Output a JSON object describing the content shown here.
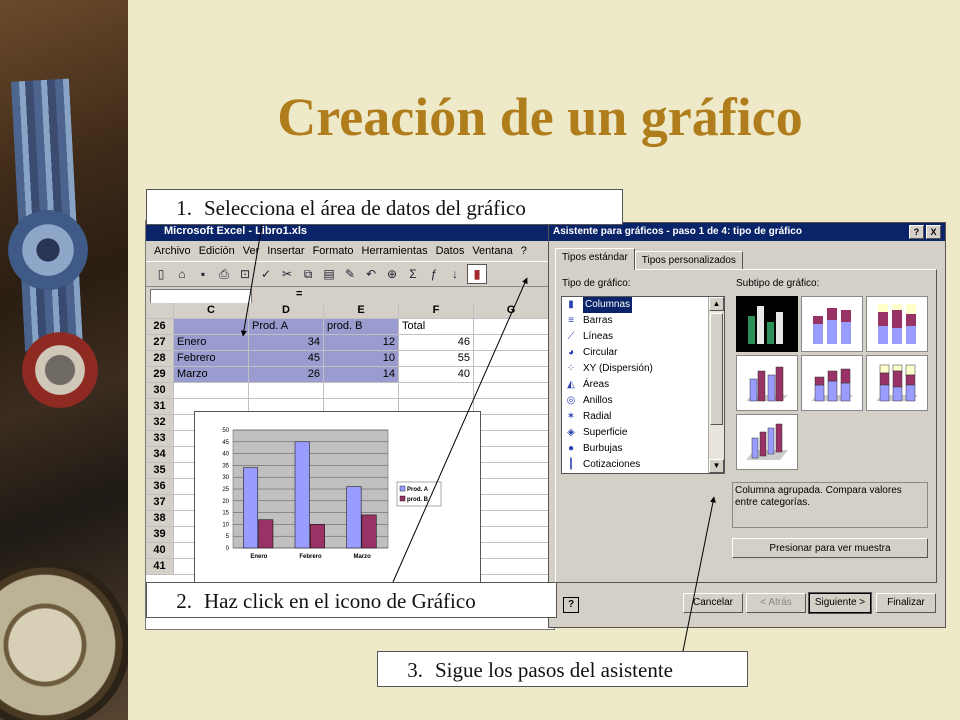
{
  "slide": {
    "title": "Creación de un gráfico",
    "steps": [
      {
        "num": "1.",
        "text": "Selecciona el área de datos del gráfico"
      },
      {
        "num": "2.",
        "text": "Haz click en el icono de Gráfico"
      },
      {
        "num": "3.",
        "text": "Sigue los pasos del asistente"
      }
    ]
  },
  "excel": {
    "window_title": "Microsoft Excel - Libro1.xls",
    "menu": [
      "Archivo",
      "Edición",
      "Ver",
      "Insertar",
      "Formato",
      "Herramientas",
      "Datos",
      "Ventana",
      "?"
    ],
    "toolbar_icons": [
      "new-icon",
      "open-icon",
      "save-icon",
      "print-icon",
      "preview-icon",
      "spell-icon",
      "cut-icon",
      "copy-icon",
      "paste-icon",
      "format-painter-icon",
      "undo-icon",
      "hyperlink-icon",
      "autosum-icon",
      "function-icon",
      "sort-icon",
      "chart-wizard-icon"
    ],
    "formula_symbol": "=",
    "columns": [
      "C",
      "D",
      "E",
      "F",
      "G"
    ],
    "rows": [
      {
        "n": "26",
        "cells": [
          "",
          "Prod. A",
          "prod. B",
          "Total",
          ""
        ]
      },
      {
        "n": "27",
        "cells": [
          "Enero",
          "34",
          "12",
          "46",
          ""
        ]
      },
      {
        "n": "28",
        "cells": [
          "Febrero",
          "45",
          "10",
          "55",
          ""
        ]
      },
      {
        "n": "29",
        "cells": [
          "Marzo",
          "26",
          "14",
          "40",
          ""
        ]
      },
      {
        "n": "30",
        "cells": [
          "",
          "",
          "",
          "",
          ""
        ]
      },
      {
        "n": "31",
        "cells": [
          "",
          "",
          "",
          "",
          ""
        ]
      },
      {
        "n": "32",
        "cells": [
          "",
          "",
          "",
          "",
          ""
        ]
      },
      {
        "n": "33",
        "cells": [
          "",
          "",
          "",
          "",
          ""
        ]
      },
      {
        "n": "34",
        "cells": [
          "",
          "",
          "",
          "",
          ""
        ]
      },
      {
        "n": "35",
        "cells": [
          "",
          "",
          "",
          "",
          ""
        ]
      },
      {
        "n": "36",
        "cells": [
          "",
          "",
          "",
          "",
          ""
        ]
      },
      {
        "n": "37",
        "cells": [
          "",
          "",
          "",
          "",
          ""
        ]
      },
      {
        "n": "38",
        "cells": [
          "",
          "",
          "",
          "",
          ""
        ]
      },
      {
        "n": "39",
        "cells": [
          "",
          "",
          "",
          "",
          ""
        ]
      },
      {
        "n": "40",
        "cells": [
          "",
          "",
          "",
          "",
          ""
        ]
      },
      {
        "n": "41",
        "cells": [
          "",
          "",
          "",
          "",
          ""
        ]
      }
    ]
  },
  "chart_data": {
    "type": "bar",
    "categories": [
      "Enero",
      "Febrero",
      "Marzo"
    ],
    "series": [
      {
        "name": "Prod. A",
        "values": [
          34,
          45,
          26
        ],
        "color": "#9a9cff"
      },
      {
        "name": "prod. B",
        "values": [
          12,
          10,
          14
        ],
        "color": "#993366"
      }
    ],
    "yticks": [
      "0",
      "5",
      "10",
      "15",
      "20",
      "25",
      "30",
      "35",
      "40",
      "45",
      "50"
    ],
    "ylim": [
      0,
      50
    ],
    "grid": true,
    "legend": "right"
  },
  "wizard": {
    "title": "Asistente para gráficos - paso 1 de 4: tipo de gráfico",
    "title_buttons": [
      "?",
      "X"
    ],
    "tabs": [
      "Tipos estándar",
      "Tipos personalizados"
    ],
    "type_label": "Tipo de gráfico:",
    "subtype_label": "Subtipo de gráfico:",
    "types": [
      {
        "label": "Columnas",
        "icon": "columns-chart-icon",
        "glyph": "▮"
      },
      {
        "label": "Barras",
        "icon": "bars-chart-icon",
        "glyph": "≡"
      },
      {
        "label": "Líneas",
        "icon": "line-chart-icon",
        "glyph": "⟋"
      },
      {
        "label": "Circular",
        "icon": "pie-chart-icon",
        "glyph": "◕"
      },
      {
        "label": "XY (Dispersión)",
        "icon": "scatter-chart-icon",
        "glyph": "⁘"
      },
      {
        "label": "Áreas",
        "icon": "area-chart-icon",
        "glyph": "◭"
      },
      {
        "label": "Anillos",
        "icon": "doughnut-chart-icon",
        "glyph": "◎"
      },
      {
        "label": "Radial",
        "icon": "radar-chart-icon",
        "glyph": "✶"
      },
      {
        "label": "Superficie",
        "icon": "surface-chart-icon",
        "glyph": "◈"
      },
      {
        "label": "Burbujas",
        "icon": "bubble-chart-icon",
        "glyph": "●"
      },
      {
        "label": "Cotizaciones",
        "icon": "stock-chart-icon",
        "glyph": "┃"
      }
    ],
    "selected_type": "Columnas",
    "description": "Columna agrupada. Compara valores entre categorías.",
    "press_button": "Presionar para ver muestra",
    "buttons": {
      "cancel": "Cancelar",
      "back": "< Atrás",
      "next": "Siguiente >",
      "finish": "Finalizar"
    },
    "help_icon": "help-icon"
  },
  "colors": {
    "title": "#b07d1c",
    "selection": "#9a9ccf",
    "dialog": "#d4d0c8",
    "titlebar": "#0a246a"
  }
}
